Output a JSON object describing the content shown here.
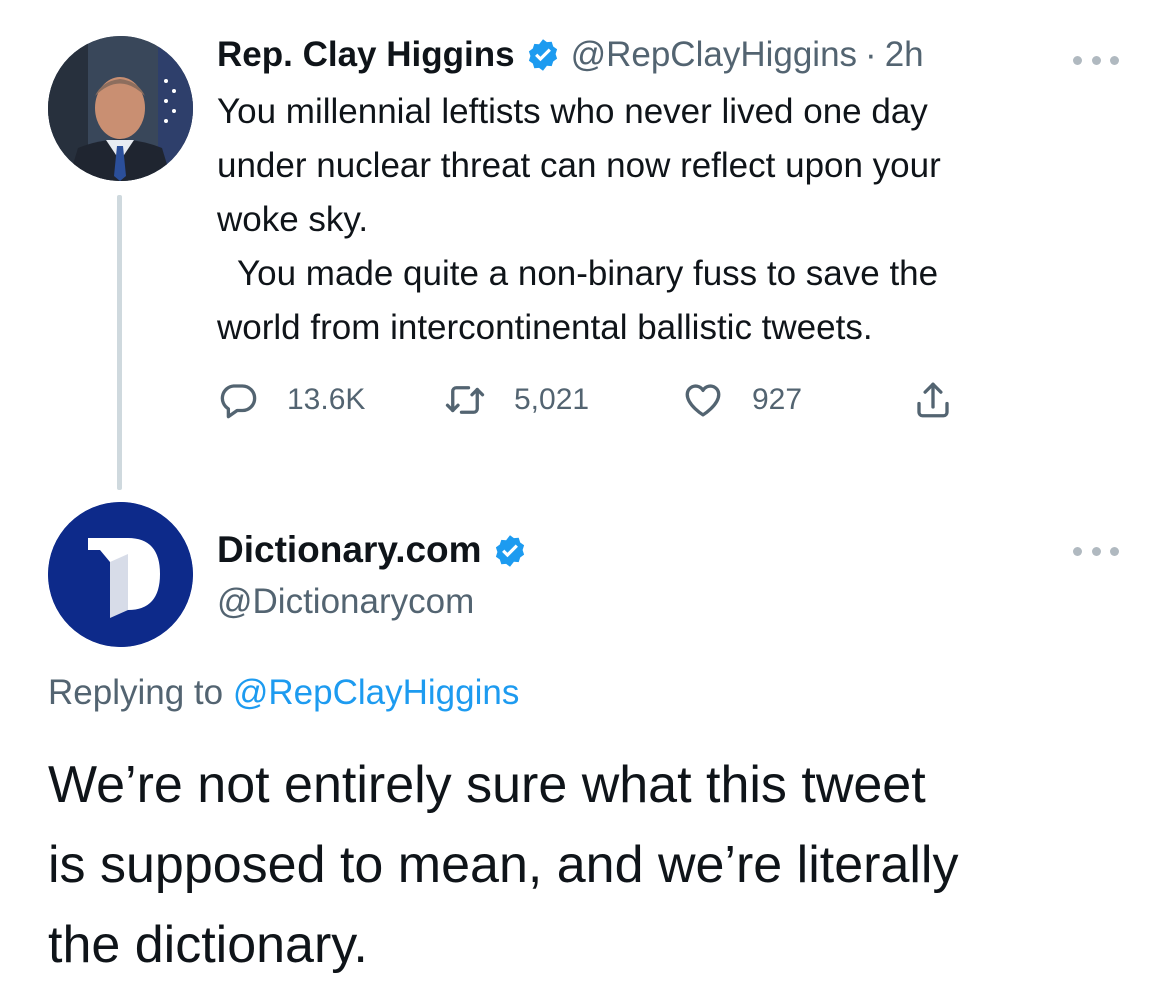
{
  "tweet1": {
    "author_name": "Rep. Clay Higgins",
    "author_handle": "@RepClayHiggins",
    "separator": "·",
    "time": "2h",
    "lines": [
      "You millennial leftists who never lived one day",
      "under nuclear threat can now reflect upon your",
      "woke sky.",
      "You made quite a non-binary fuss to save the",
      "world from intercontinental ballistic tweets."
    ],
    "stats": {
      "replies": "13.6K",
      "retweets": "5,021",
      "likes": "927"
    }
  },
  "tweet2": {
    "author_name": "Dictionary.com",
    "author_handle": "@Dictionarycom",
    "replying_prefix": "Replying to",
    "replying_to": "@RepClayHiggins",
    "lines": [
      "We’re not entirely sure what this tweet",
      "is supposed to mean, and we’re literally",
      "the dictionary."
    ]
  },
  "icons": {
    "verified": "verified-badge-icon",
    "more": "more-horizontal-icon",
    "reply": "reply-icon",
    "retweet": "retweet-icon",
    "like": "heart-icon",
    "share": "share-icon"
  },
  "colors": {
    "verified_blue": "#1d9bf0",
    "link_blue": "#1d9bf0",
    "secondary_text": "#536471",
    "primary_text": "#0f1419",
    "dictionary_navy": "#0d2a8a"
  }
}
